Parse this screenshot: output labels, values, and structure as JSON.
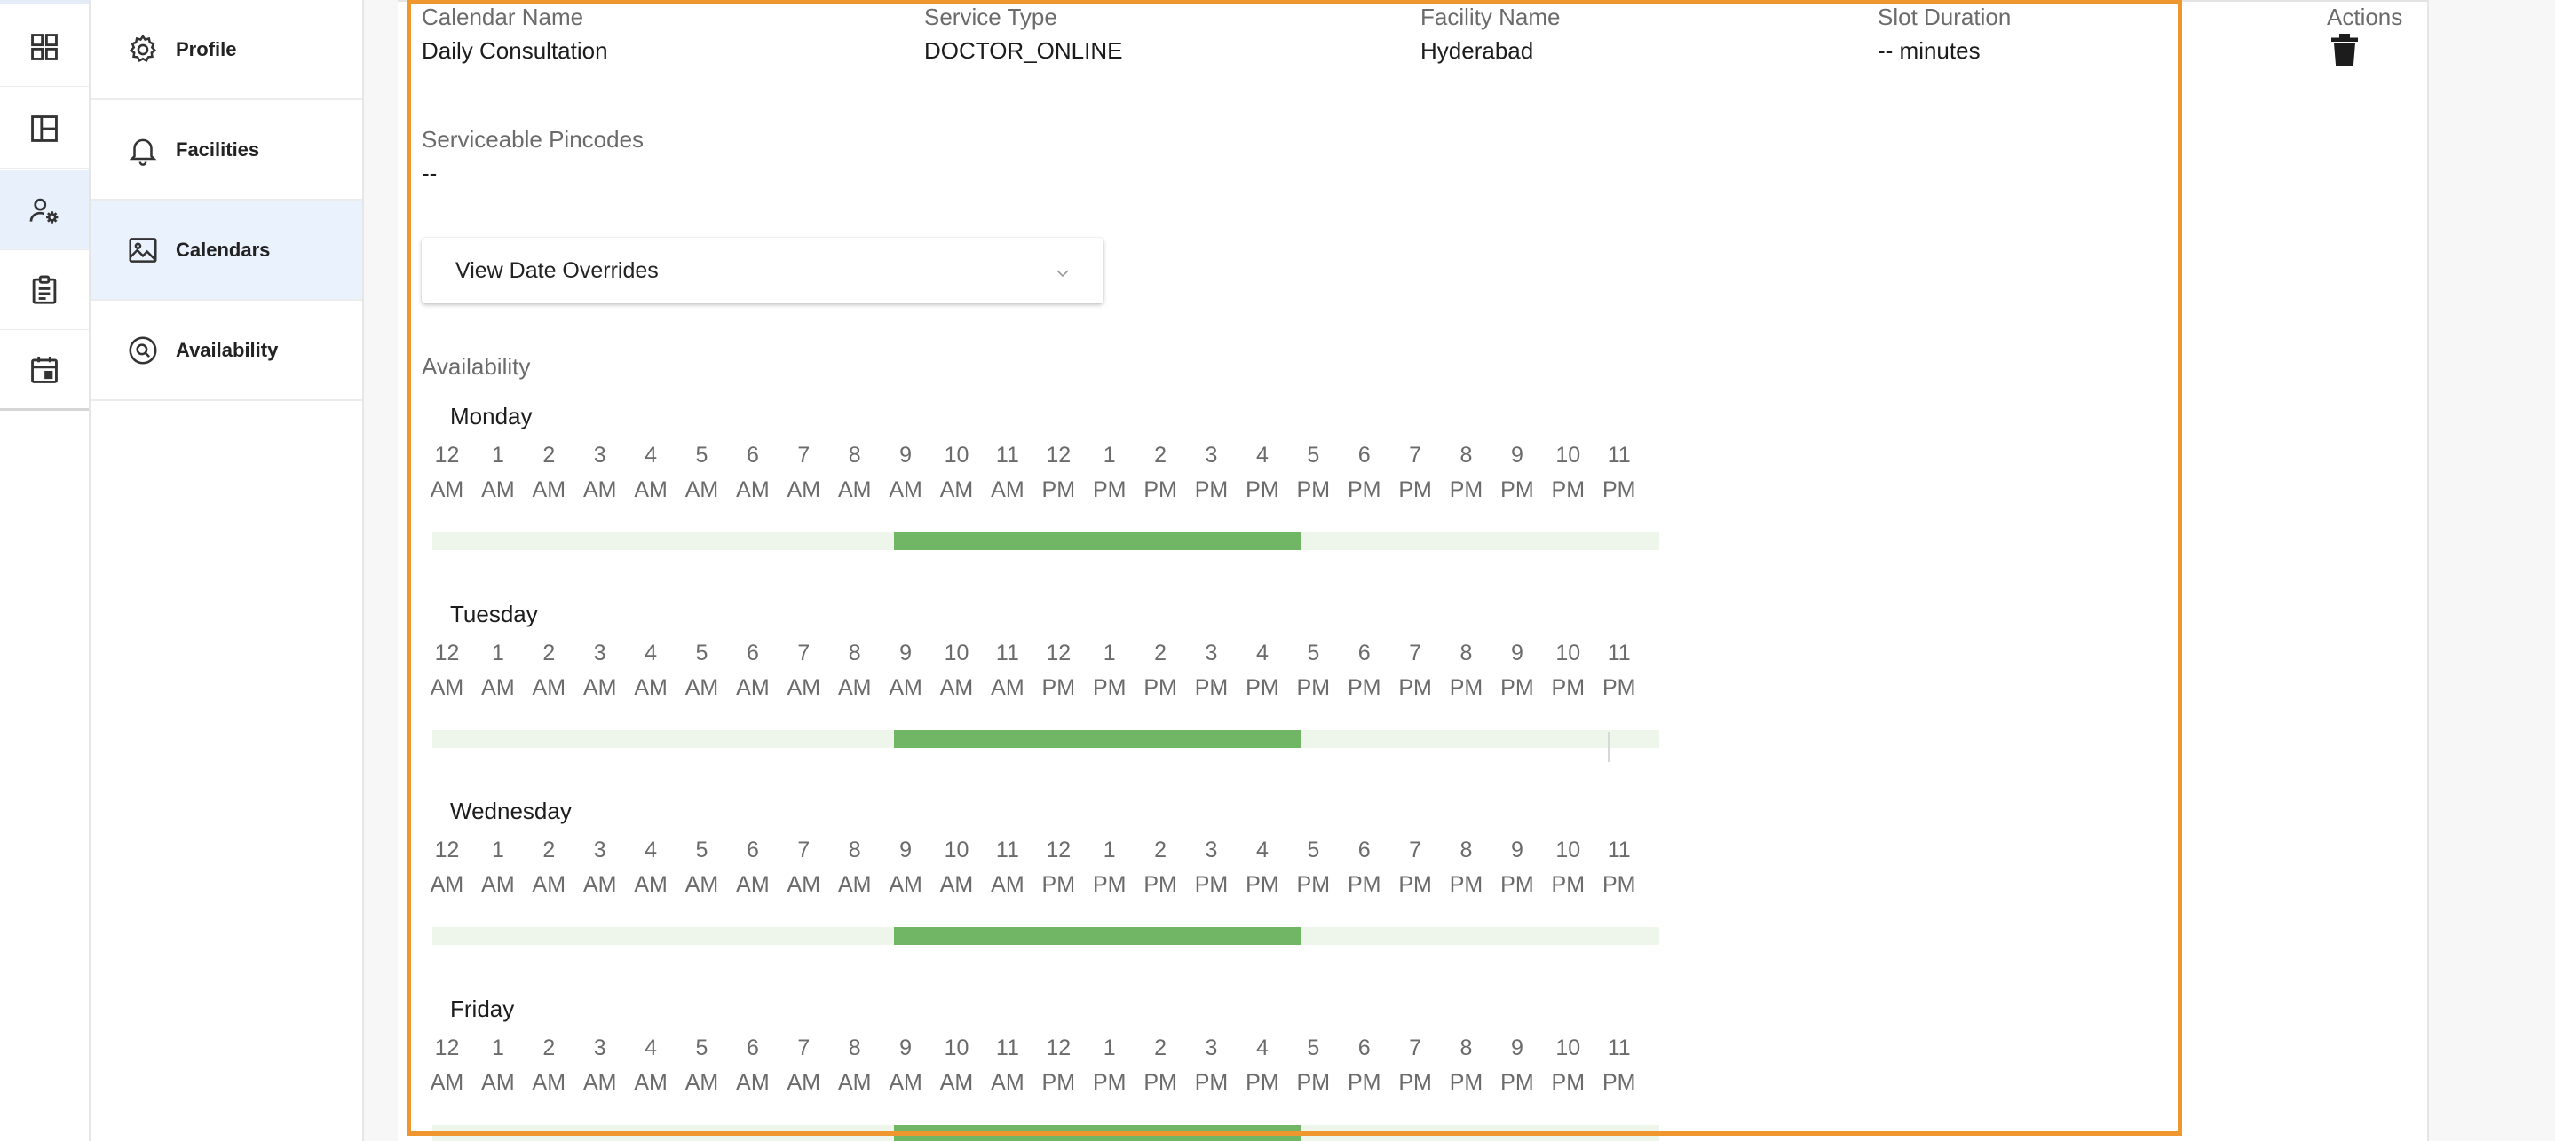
{
  "rail": {
    "items": [
      {
        "icon": "dashboard-grid-icon",
        "active": false
      },
      {
        "icon": "layout-panel-icon",
        "active": false
      },
      {
        "icon": "user-settings-icon",
        "active": true
      },
      {
        "icon": "clipboard-icon",
        "active": false
      },
      {
        "icon": "calendar-icon",
        "active": false
      }
    ]
  },
  "subnav": {
    "items": [
      {
        "label": "Profile",
        "icon": "gear-icon",
        "active": false
      },
      {
        "label": "Facilities",
        "icon": "bell-icon",
        "active": false
      },
      {
        "label": "Calendars",
        "icon": "image-icon",
        "active": true
      },
      {
        "label": "Availability",
        "icon": "search-circle-icon",
        "active": false
      }
    ]
  },
  "calendar": {
    "calendar_name_label": "Calendar Name",
    "calendar_name": "Daily Consultation",
    "service_type_label": "Service Type",
    "service_type": "DOCTOR_ONLINE",
    "facility_name_label": "Facility Name",
    "facility_name": "Hyderabad",
    "slot_duration_label": "Slot Duration",
    "slot_duration": "-- minutes",
    "actions_label": "Actions",
    "pincodes_label": "Serviceable Pincodes",
    "pincodes": "--",
    "overrides_label": "View Date Overrides",
    "availability_label": "Availability"
  },
  "hours": [
    [
      "12",
      "AM"
    ],
    [
      "1",
      "AM"
    ],
    [
      "2",
      "AM"
    ],
    [
      "3",
      "AM"
    ],
    [
      "4",
      "AM"
    ],
    [
      "5",
      "AM"
    ],
    [
      "6",
      "AM"
    ],
    [
      "7",
      "AM"
    ],
    [
      "8",
      "AM"
    ],
    [
      "9",
      "AM"
    ],
    [
      "10",
      "AM"
    ],
    [
      "11",
      "AM"
    ],
    [
      "12",
      "PM"
    ],
    [
      "1",
      "PM"
    ],
    [
      "2",
      "PM"
    ],
    [
      "3",
      "PM"
    ],
    [
      "4",
      "PM"
    ],
    [
      "5",
      "PM"
    ],
    [
      "6",
      "PM"
    ],
    [
      "7",
      "PM"
    ],
    [
      "8",
      "PM"
    ],
    [
      "9",
      "PM"
    ],
    [
      "10",
      "PM"
    ],
    [
      "11",
      "PM"
    ]
  ],
  "days": [
    {
      "name": "Monday",
      "slot_start_hour": 9,
      "slot_end_hour": 17
    },
    {
      "name": "Tuesday",
      "slot_start_hour": 9,
      "slot_end_hour": 17
    },
    {
      "name": "Wednesday",
      "slot_start_hour": 9,
      "slot_end_hour": 17
    },
    {
      "name": "Friday",
      "slot_start_hour": 9,
      "slot_end_hour": 17
    }
  ],
  "colors": {
    "accent": "#f0962f",
    "slot": "#71b665",
    "track": "#eef6ec",
    "active_nav": "#eaf2fd"
  }
}
